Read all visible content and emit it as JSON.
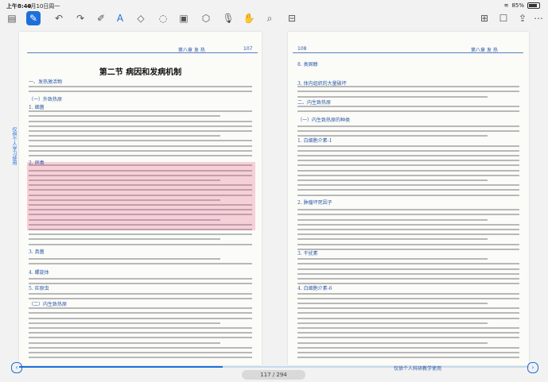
{
  "status": {
    "time": "上午8:40",
    "date": "4月10日周一",
    "battery": "85%"
  },
  "left_header": {
    "chapter": "第八章  发  热",
    "page": "107"
  },
  "right_header": {
    "page": "108",
    "chapter": "第八章  发  热"
  },
  "title": "第二节  病因和发病机制",
  "left_sections": [
    "一、发热激活物",
    "（一）外致热原",
    "1. 细菌",
    "2. 病毒",
    "3. 真菌",
    "4. 螺旋体",
    "5. 疟原虫",
    "（二）内生致热原"
  ],
  "right_sections": [
    "8. 类固醇",
    "3. 体内组织的大量破坏",
    "二、内生致热原",
    "（一）内生致热原的种类",
    "1. 白细胞介素-1",
    "2. 肿瘤坏死因子",
    "3. 干扰素",
    "4. 白细胞介素-6"
  ],
  "sidetab": "仅供个人学习使用",
  "page_indicator": "117 / 294",
  "footer": "仅供个人科研教学使用",
  "progress": 0.4
}
